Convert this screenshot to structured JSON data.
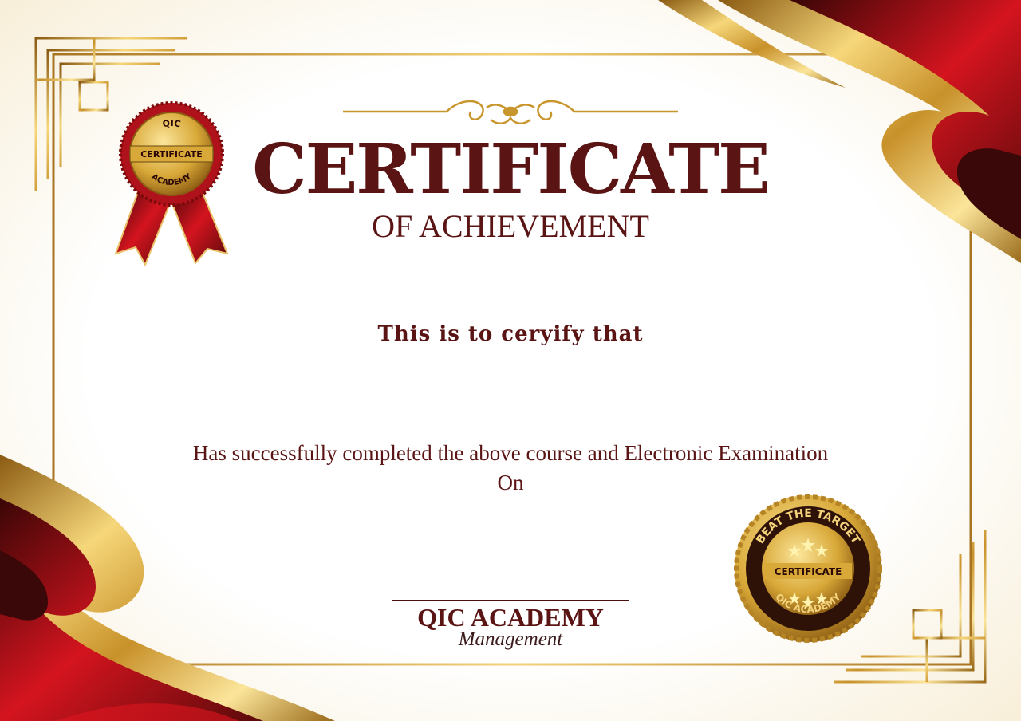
{
  "certificate": {
    "title": "CERTIFICATE",
    "subtitle": "OF ACHIEVEMENT",
    "certify_line": "This is to ceryify that",
    "completion_line": "Has successfully completed the above course and Electronic Examination",
    "on_line": "On",
    "organization": "QIC ACADEMY",
    "signatory_role": "Management"
  },
  "ribbon_seal": {
    "top_text": "QIC",
    "center_text": "CERTIFICATE",
    "bottom_text": "ACADEMY"
  },
  "gold_seal": {
    "top_text": "BEAT THE TARGET",
    "center_text": "CERTIFICATE",
    "bottom_text": "QIC ACADEMY"
  },
  "colors": {
    "text": "#5a1414",
    "gold": "#d4a93a",
    "red": "#b0121b",
    "dark": "#2a0808",
    "paper": "#fdf8ee"
  }
}
